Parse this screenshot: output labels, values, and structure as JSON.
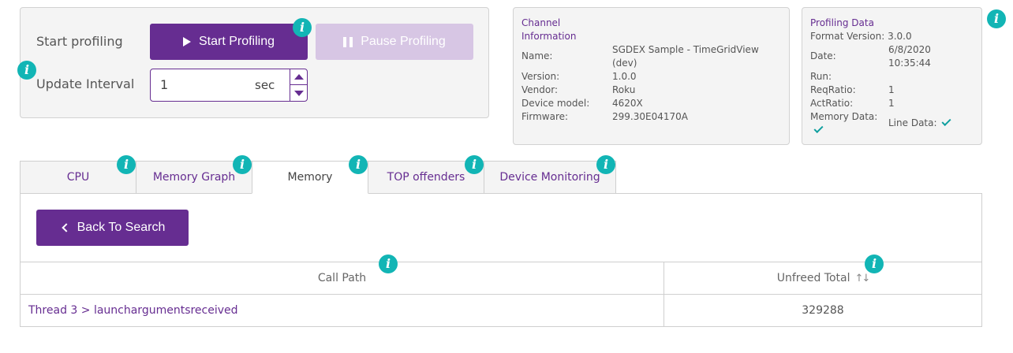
{
  "controls": {
    "start_label": "Start profiling",
    "start_button": "Start Profiling",
    "pause_button": "Pause Profiling",
    "interval_label": "Update Interval",
    "interval_value": "1",
    "interval_unit": "sec"
  },
  "channel": {
    "title_line1": "Channel",
    "title_line2": "Information",
    "rows": [
      {
        "key": "Name:",
        "value_line1": "SGDEX Sample - TimeGridView",
        "value_line2": "(dev)"
      },
      {
        "key": "Version:",
        "value": "1.0.0"
      },
      {
        "key": "Vendor:",
        "value": "Roku"
      },
      {
        "key": "Device model:",
        "value": "4620X"
      },
      {
        "key": "Firmware:",
        "value": "299.30E04170A"
      }
    ]
  },
  "profiling_data": {
    "title": "Profiling Data",
    "format_version": "Format Version: 3.0.0",
    "date_key": "Date:",
    "date_value_line1": "6/8/2020",
    "date_value_line2": "10:35:44",
    "run_key": "Run:",
    "req_ratio_key": "ReqRatio:",
    "req_ratio_value": "1",
    "act_ratio_key": "ActRatio:",
    "act_ratio_value": "1",
    "memory_data_key": "Memory Data:",
    "line_data_key": "Line Data:"
  },
  "info_icon": "i",
  "tabs": [
    {
      "label": "CPU",
      "active": false
    },
    {
      "label": "Memory Graph",
      "active": false
    },
    {
      "label": "Memory",
      "active": true
    },
    {
      "label": "TOP offenders",
      "active": false
    },
    {
      "label": "Device Monitoring",
      "active": false
    }
  ],
  "memory": {
    "back_button": "Back To Search",
    "columns": [
      "Call Path",
      "Unfreed Total"
    ],
    "rows": [
      {
        "call_path": "Thread 3 > launchargumentsreceived",
        "unfreed_total": "329288"
      }
    ]
  },
  "colors": {
    "accent": "#662d91",
    "accent_disabled": "#d7c6e4",
    "info": "#12b5b5",
    "check": "#0f9f9f"
  }
}
